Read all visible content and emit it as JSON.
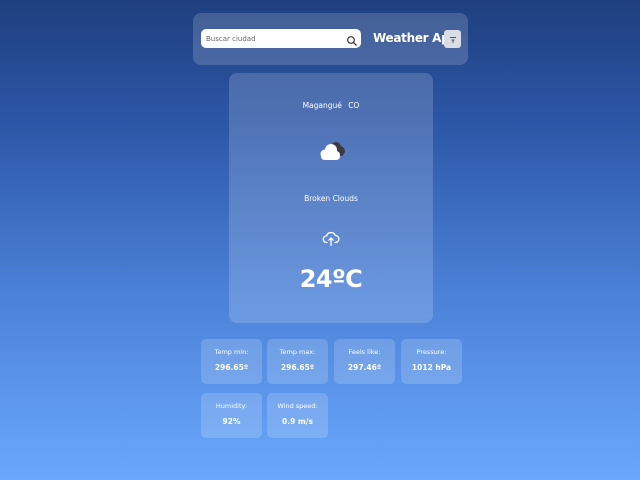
{
  "header": {
    "search_placeholder": "Buscar ciudad",
    "search_value": "",
    "title": "Weather App"
  },
  "current": {
    "city": "Magangué",
    "country": "CO",
    "icon": "broken-clouds-icon",
    "description": "Broken Clouds",
    "temperature": "24ºC"
  },
  "stats": [
    {
      "label": "Temp min:",
      "value": "296.65º"
    },
    {
      "label": "Temp max:",
      "value": "296.65º"
    },
    {
      "label": "Feels like:",
      "value": "297.46º"
    },
    {
      "label": "Pressure:",
      "value": "1012 hPa"
    },
    {
      "label": "Humidity:",
      "value": "92%"
    },
    {
      "label": "Wind speed:",
      "value": "0.9 m/s"
    }
  ]
}
